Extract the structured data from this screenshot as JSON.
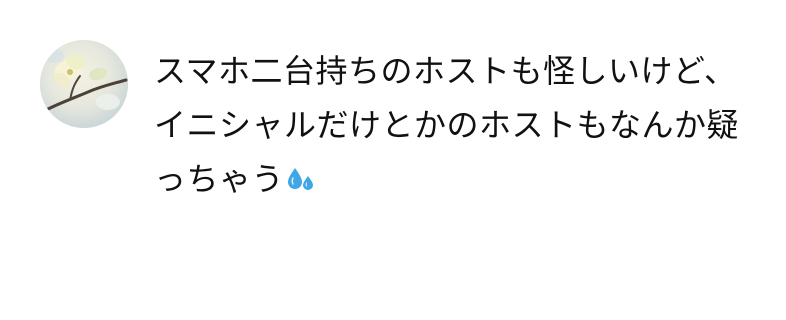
{
  "comment": {
    "avatar_icon": "flower-photo-avatar",
    "lines": [
      "スマホ二台持ちのホストも怪しいけど、",
      "イニシャルだけとかのホストもなんか疑",
      "っちゃう"
    ],
    "emoji_icon": "sweat-droplets-icon",
    "text_color": "#111111"
  }
}
